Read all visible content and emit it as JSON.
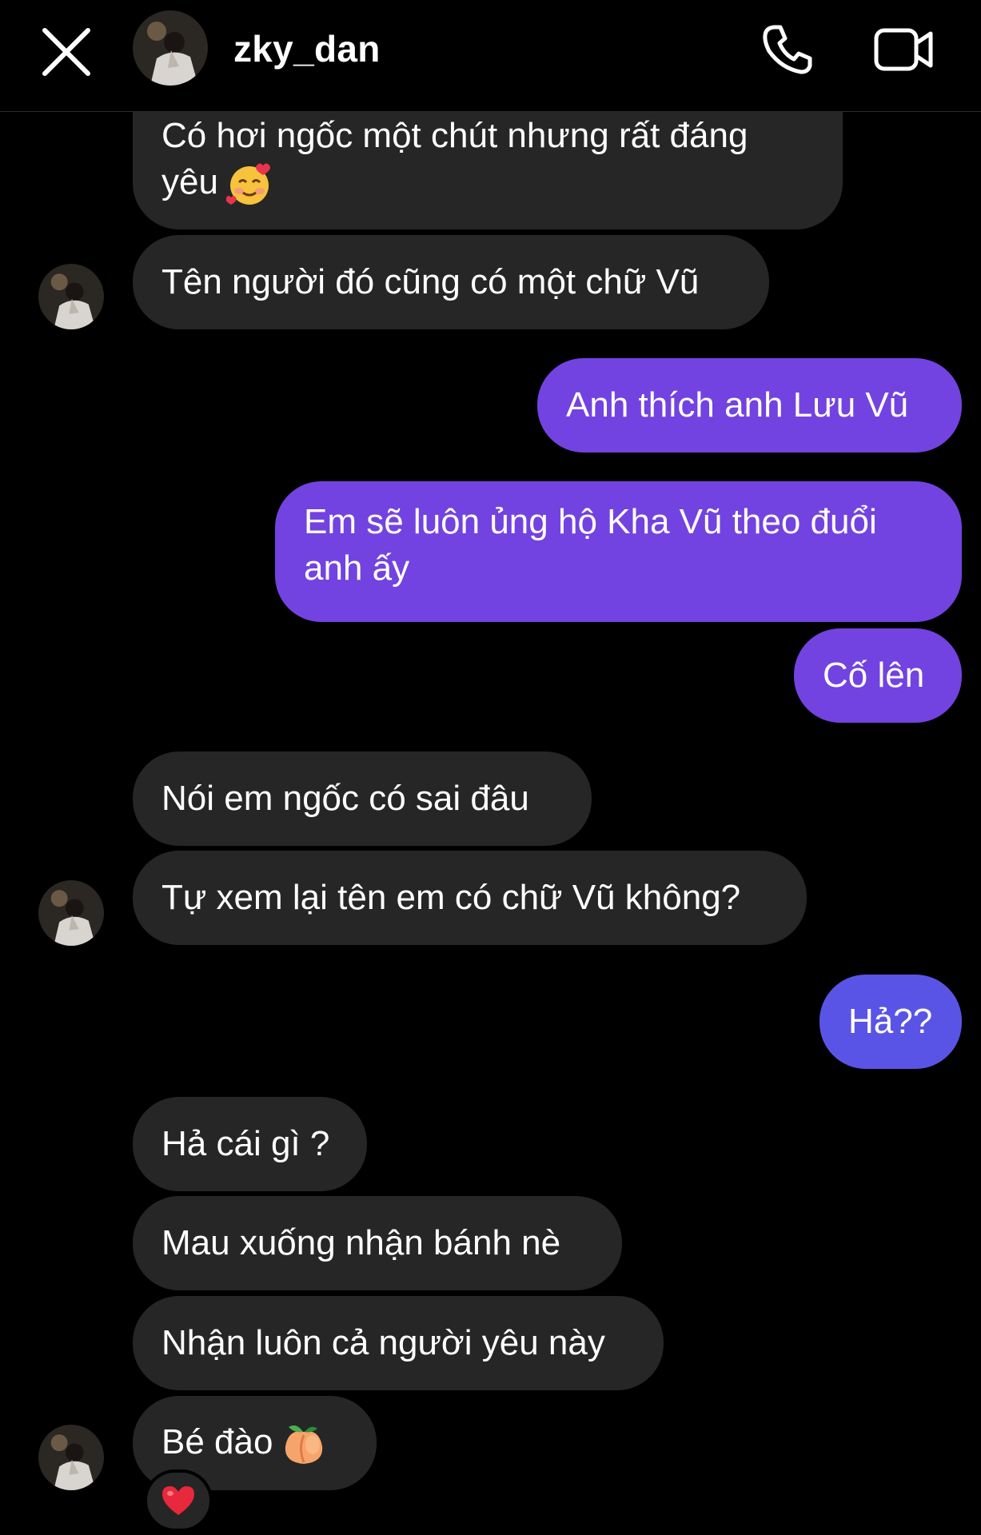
{
  "header": {
    "username": "zky_dan",
    "close_icon": "close-icon",
    "call_icon": "phone-icon",
    "video_icon": "video-camera-icon"
  },
  "colors": {
    "background": "#000000",
    "received_bubble": "#262626",
    "sent_bubble": "#7243e0",
    "sent_bubble_last": "#5a54e6"
  },
  "messages": [
    {
      "side": "received",
      "text": "Có hơi ngốc một chút nhưng rất đáng yêu",
      "emoji": "smiling-face-with-hearts"
    },
    {
      "side": "received",
      "text": "Tên người đó cũng có một chữ Vũ"
    },
    {
      "side": "sent",
      "text": "Anh thích anh Lưu Vũ"
    },
    {
      "side": "sent",
      "text": "Em sẽ luôn ủng hộ Kha Vũ theo đuổi anh ấy"
    },
    {
      "side": "sent",
      "text": "Cố lên"
    },
    {
      "side": "received",
      "text": "Nói em ngốc có sai đâu"
    },
    {
      "side": "received",
      "text": "Tự xem lại tên em có chữ Vũ không?"
    },
    {
      "side": "sent",
      "text": "Hả??"
    },
    {
      "side": "received",
      "text": "Hả cái gì ?"
    },
    {
      "side": "received",
      "text": "Mau xuống nhận bánh nè"
    },
    {
      "side": "received",
      "text": "Nhận luôn cả người yêu này"
    },
    {
      "side": "received",
      "text": "Bé đào",
      "emoji": "peach",
      "reaction": "red-heart"
    }
  ]
}
